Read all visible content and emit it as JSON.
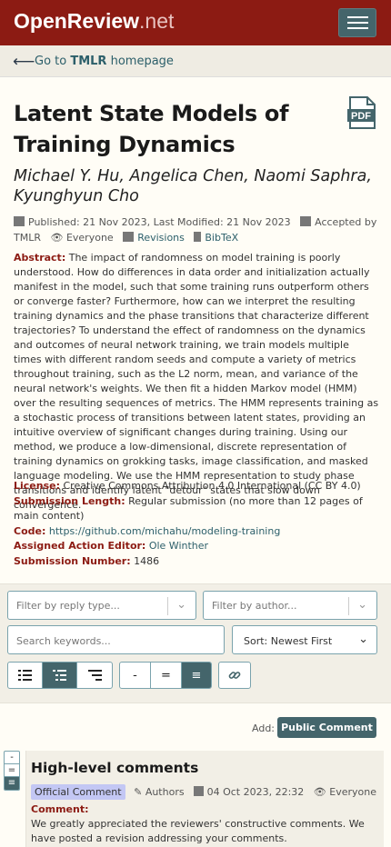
{
  "navbar": {
    "brand_main": "OpenReview",
    "brand_tld": ".net",
    "menu_icon": "hamburger-icon"
  },
  "back": {
    "prefix": "Go to ",
    "venue": "TMLR",
    "suffix": " homepage"
  },
  "paper": {
    "title": "Latent State Models of Training Dynamics",
    "pdf_label": "PDF",
    "authors": "Michael Y. Hu, Angelica Chen, Naomi Saphra, Kyunghyun Cho",
    "published": "Published: 21 Nov 2023, Last Modified: 21 Nov 2023",
    "accepted": "Accepted by TMLR",
    "visibility": "Everyone",
    "revisions": "Revisions",
    "bibtex": "BibTeX",
    "abstract_label": "Abstract:",
    "abstract": "The impact of randomness on model training is poorly understood. How do differences in data order and initialization actually manifest in the model, such that some training runs outperform others or converge faster? Furthermore, how can we interpret the resulting training dynamics and the phase transitions that characterize different trajectories? To understand the effect of randomness on the dynamics and outcomes of neural network training, we train models multiple times with different random seeds and compute a variety of metrics throughout training, such as the L2 norm, mean, and variance of the neural network's weights. We then fit a hidden Markov model (HMM) over the resulting sequences of metrics. The HMM represents training as a stochastic process of transitions between latent states, providing an intuitive overview of significant changes during training. Using our method, we produce a low-dimensional, discrete representation of training dynamics on grokking tasks, image classification, and masked language modeling. We use the HMM representation to study phase transitions and identify latent \"detour\" states that slow down convergence.",
    "license_label": "License:",
    "license": "Creative Commons Attribution 4.0 International (CC BY 4.0)",
    "length_label": "Submission Length:",
    "length": "Regular submission (no more than 12 pages of main content)",
    "code_label": "Code:",
    "code": "https://github.com/michahu/modeling-training",
    "editor_label": "Assigned Action Editor:",
    "editor": "Ole Winther",
    "number_label": "Submission Number:",
    "number": "1486"
  },
  "filters": {
    "reply_type_placeholder": "Filter by reply type...",
    "author_placeholder": "Filter by author...",
    "search_placeholder": "Search keywords...",
    "sort_value": "Sort: Newest First",
    "collapse_minus": "-",
    "collapse_equal": "=",
    "collapse_full": "≡"
  },
  "add": {
    "label": "Add:",
    "button": "Public Comment"
  },
  "note": {
    "collapse_minus": "-",
    "collapse_equal": "=",
    "collapse_full": "≡",
    "title": "High-level comments",
    "badge": "Official Comment",
    "signatures": "Authors",
    "date": "04 Oct 2023, 22:32",
    "visibility": "Everyone",
    "comment_label": "Comment:",
    "comment": "We greatly appreciated the reviewers' constructive comments. We have posted a revision addressing your comments."
  },
  "colors": {
    "navbar": "#8c1b13",
    "accent": "#44656b",
    "badge": "#c3c7f4",
    "label": "#8c1b13"
  }
}
